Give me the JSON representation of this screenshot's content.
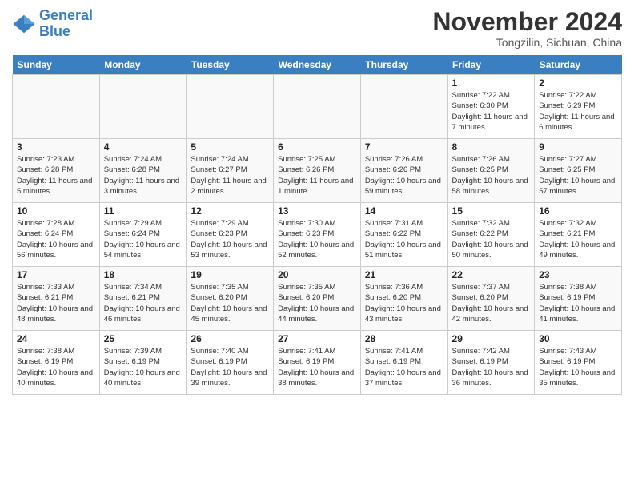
{
  "header": {
    "logo_line1": "General",
    "logo_line2": "Blue",
    "month_title": "November 2024",
    "subtitle": "Tongzilin, Sichuan, China"
  },
  "weekdays": [
    "Sunday",
    "Monday",
    "Tuesday",
    "Wednesday",
    "Thursday",
    "Friday",
    "Saturday"
  ],
  "weeks": [
    [
      {
        "day": "",
        "info": "",
        "empty": true
      },
      {
        "day": "",
        "info": "",
        "empty": true
      },
      {
        "day": "",
        "info": "",
        "empty": true
      },
      {
        "day": "",
        "info": "",
        "empty": true
      },
      {
        "day": "",
        "info": "",
        "empty": true
      },
      {
        "day": "1",
        "info": "Sunrise: 7:22 AM\nSunset: 6:30 PM\nDaylight: 11 hours and 7 minutes.",
        "empty": false
      },
      {
        "day": "2",
        "info": "Sunrise: 7:22 AM\nSunset: 6:29 PM\nDaylight: 11 hours and 6 minutes.",
        "empty": false
      }
    ],
    [
      {
        "day": "3",
        "info": "Sunrise: 7:23 AM\nSunset: 6:28 PM\nDaylight: 11 hours and 5 minutes.",
        "empty": false
      },
      {
        "day": "4",
        "info": "Sunrise: 7:24 AM\nSunset: 6:28 PM\nDaylight: 11 hours and 3 minutes.",
        "empty": false
      },
      {
        "day": "5",
        "info": "Sunrise: 7:24 AM\nSunset: 6:27 PM\nDaylight: 11 hours and 2 minutes.",
        "empty": false
      },
      {
        "day": "6",
        "info": "Sunrise: 7:25 AM\nSunset: 6:26 PM\nDaylight: 11 hours and 1 minute.",
        "empty": false
      },
      {
        "day": "7",
        "info": "Sunrise: 7:26 AM\nSunset: 6:26 PM\nDaylight: 10 hours and 59 minutes.",
        "empty": false
      },
      {
        "day": "8",
        "info": "Sunrise: 7:26 AM\nSunset: 6:25 PM\nDaylight: 10 hours and 58 minutes.",
        "empty": false
      },
      {
        "day": "9",
        "info": "Sunrise: 7:27 AM\nSunset: 6:25 PM\nDaylight: 10 hours and 57 minutes.",
        "empty": false
      }
    ],
    [
      {
        "day": "10",
        "info": "Sunrise: 7:28 AM\nSunset: 6:24 PM\nDaylight: 10 hours and 56 minutes.",
        "empty": false
      },
      {
        "day": "11",
        "info": "Sunrise: 7:29 AM\nSunset: 6:24 PM\nDaylight: 10 hours and 54 minutes.",
        "empty": false
      },
      {
        "day": "12",
        "info": "Sunrise: 7:29 AM\nSunset: 6:23 PM\nDaylight: 10 hours and 53 minutes.",
        "empty": false
      },
      {
        "day": "13",
        "info": "Sunrise: 7:30 AM\nSunset: 6:23 PM\nDaylight: 10 hours and 52 minutes.",
        "empty": false
      },
      {
        "day": "14",
        "info": "Sunrise: 7:31 AM\nSunset: 6:22 PM\nDaylight: 10 hours and 51 minutes.",
        "empty": false
      },
      {
        "day": "15",
        "info": "Sunrise: 7:32 AM\nSunset: 6:22 PM\nDaylight: 10 hours and 50 minutes.",
        "empty": false
      },
      {
        "day": "16",
        "info": "Sunrise: 7:32 AM\nSunset: 6:21 PM\nDaylight: 10 hours and 49 minutes.",
        "empty": false
      }
    ],
    [
      {
        "day": "17",
        "info": "Sunrise: 7:33 AM\nSunset: 6:21 PM\nDaylight: 10 hours and 48 minutes.",
        "empty": false
      },
      {
        "day": "18",
        "info": "Sunrise: 7:34 AM\nSunset: 6:21 PM\nDaylight: 10 hours and 46 minutes.",
        "empty": false
      },
      {
        "day": "19",
        "info": "Sunrise: 7:35 AM\nSunset: 6:20 PM\nDaylight: 10 hours and 45 minutes.",
        "empty": false
      },
      {
        "day": "20",
        "info": "Sunrise: 7:35 AM\nSunset: 6:20 PM\nDaylight: 10 hours and 44 minutes.",
        "empty": false
      },
      {
        "day": "21",
        "info": "Sunrise: 7:36 AM\nSunset: 6:20 PM\nDaylight: 10 hours and 43 minutes.",
        "empty": false
      },
      {
        "day": "22",
        "info": "Sunrise: 7:37 AM\nSunset: 6:20 PM\nDaylight: 10 hours and 42 minutes.",
        "empty": false
      },
      {
        "day": "23",
        "info": "Sunrise: 7:38 AM\nSunset: 6:19 PM\nDaylight: 10 hours and 41 minutes.",
        "empty": false
      }
    ],
    [
      {
        "day": "24",
        "info": "Sunrise: 7:38 AM\nSunset: 6:19 PM\nDaylight: 10 hours and 40 minutes.",
        "empty": false
      },
      {
        "day": "25",
        "info": "Sunrise: 7:39 AM\nSunset: 6:19 PM\nDaylight: 10 hours and 40 minutes.",
        "empty": false
      },
      {
        "day": "26",
        "info": "Sunrise: 7:40 AM\nSunset: 6:19 PM\nDaylight: 10 hours and 39 minutes.",
        "empty": false
      },
      {
        "day": "27",
        "info": "Sunrise: 7:41 AM\nSunset: 6:19 PM\nDaylight: 10 hours and 38 minutes.",
        "empty": false
      },
      {
        "day": "28",
        "info": "Sunrise: 7:41 AM\nSunset: 6:19 PM\nDaylight: 10 hours and 37 minutes.",
        "empty": false
      },
      {
        "day": "29",
        "info": "Sunrise: 7:42 AM\nSunset: 6:19 PM\nDaylight: 10 hours and 36 minutes.",
        "empty": false
      },
      {
        "day": "30",
        "info": "Sunrise: 7:43 AM\nSunset: 6:19 PM\nDaylight: 10 hours and 35 minutes.",
        "empty": false
      }
    ]
  ]
}
